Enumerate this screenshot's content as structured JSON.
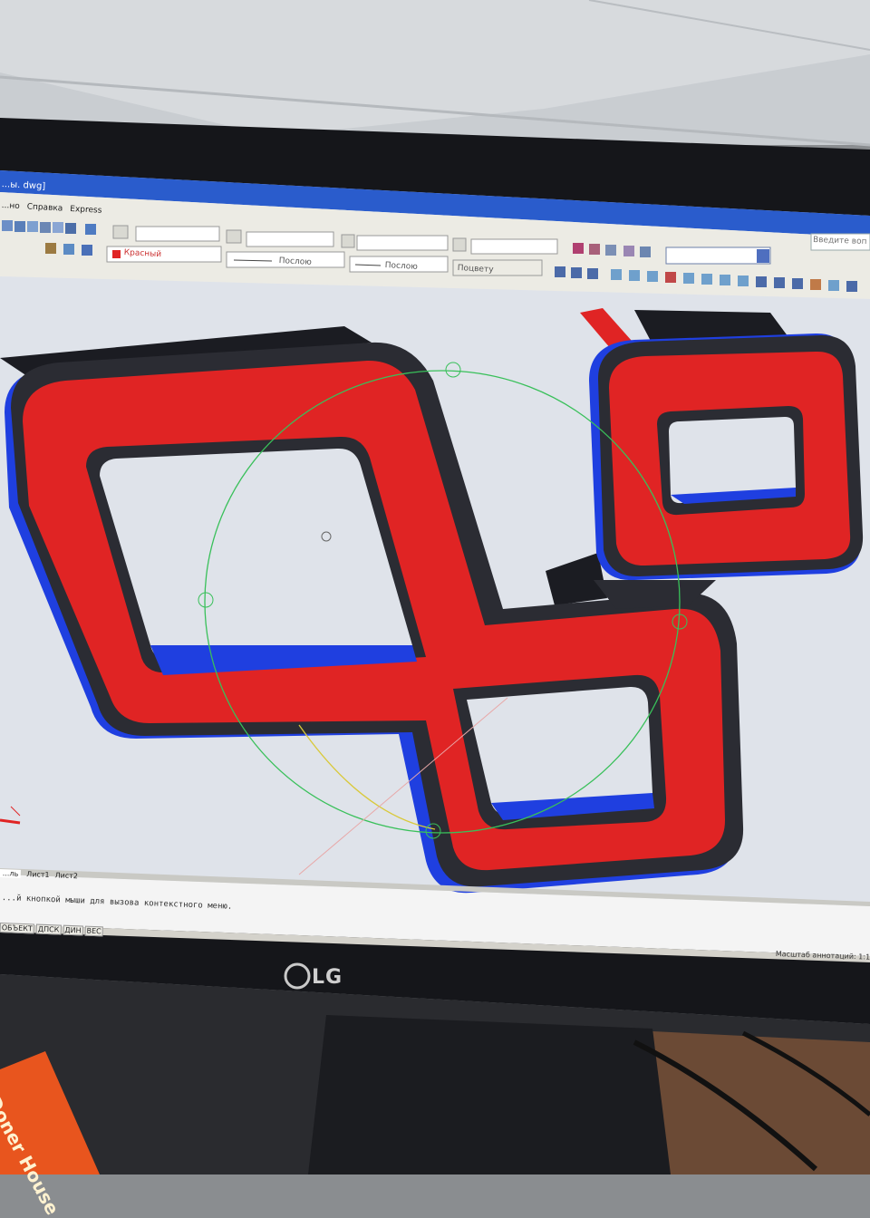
{
  "window": {
    "title": "...ы. dwg]"
  },
  "menu": {
    "items": [
      "...но",
      "Справка",
      "Express"
    ]
  },
  "help_search": {
    "placeholder": "Введите вопро"
  },
  "properties_toolbar": {
    "color_value": "Красный",
    "linetype_value": "Послою",
    "lineweight_value": "Послою",
    "plotstyle_value": "Поцвету"
  },
  "layout_tabs": [
    "...ль",
    "Лист1",
    "Лист2"
  ],
  "command_line": {
    "text": "...й кнопкой мыши для вызова контекстного меню."
  },
  "status_bar": {
    "toggles": [
      "ОБЪЕКТ",
      "ДПСК",
      "ДИН",
      "ВЕС"
    ],
    "annotation_scale": "Масштаб аннотаций:  1:1 ▾"
  },
  "monitor": {
    "brand": "LG"
  },
  "desk_item": {
    "text": "Doner House"
  },
  "colors": {
    "part_red": "#e02424",
    "part_blue": "#1f3fe0",
    "part_dark": "#2b2c33",
    "viewport_bg": "#dfe3ea",
    "orbit_circle": "#39c05a"
  }
}
